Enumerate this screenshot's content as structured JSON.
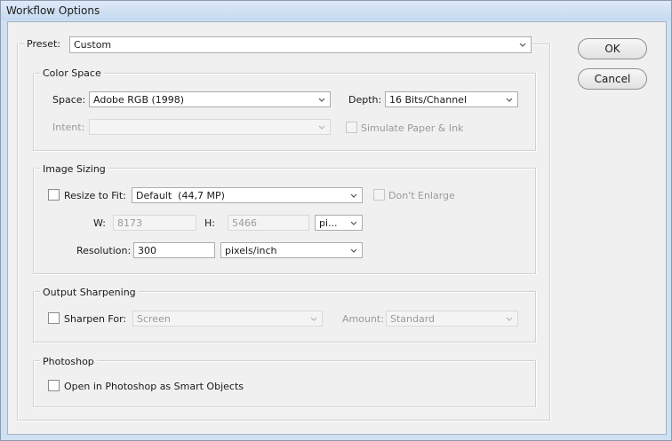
{
  "window": {
    "title": "Workflow Options"
  },
  "preset": {
    "label": "Preset:",
    "value": "Custom"
  },
  "color_space": {
    "title": "Color Space",
    "space_label": "Space:",
    "space_value": "Adobe RGB (1998)",
    "depth_label": "Depth:",
    "depth_value": "16 Bits/Channel",
    "intent_label": "Intent:",
    "intent_value": "",
    "simulate_label": "Simulate Paper & Ink"
  },
  "image_sizing": {
    "title": "Image Sizing",
    "resize_label": "Resize to Fit:",
    "resize_value": "Default  (44,7 MP)",
    "dont_enlarge_label": "Don't Enlarge",
    "w_label": "W:",
    "w_value": "8173",
    "h_label": "H:",
    "h_value": "5466",
    "unit_value": "pi...",
    "resolution_label": "Resolution:",
    "resolution_value": "300",
    "resolution_unit": "pixels/inch"
  },
  "output_sharpening": {
    "title": "Output Sharpening",
    "sharpen_label": "Sharpen For:",
    "sharpen_value": "Screen",
    "amount_label": "Amount:",
    "amount_value": "Standard"
  },
  "photoshop": {
    "title": "Photoshop",
    "smart_objects_label": "Open in Photoshop as Smart Objects"
  },
  "buttons": {
    "ok": "OK",
    "cancel": "Cancel"
  }
}
